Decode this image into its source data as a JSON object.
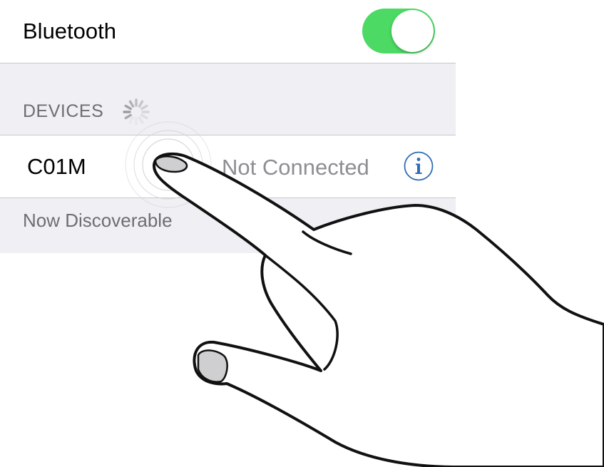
{
  "bluetooth": {
    "label": "Bluetooth",
    "toggle_state": "on",
    "toggle_color": "#4cd964"
  },
  "devices_section": {
    "header": "DEVICES",
    "spinner_icon": "activity-spinner-icon"
  },
  "devices": [
    {
      "name": "C01M",
      "status": "Not Connected",
      "info_icon": "info-icon",
      "info_color": "#2f6db5"
    }
  ],
  "footer": {
    "text": "Now Discoverable"
  },
  "colors": {
    "background": "#efeff4",
    "separator": "#c8c7cc",
    "secondary_text": "#8e8e93",
    "section_text": "#6d6d72"
  },
  "overlay": {
    "gesture_icon": "tap-gesture-hand-icon"
  }
}
